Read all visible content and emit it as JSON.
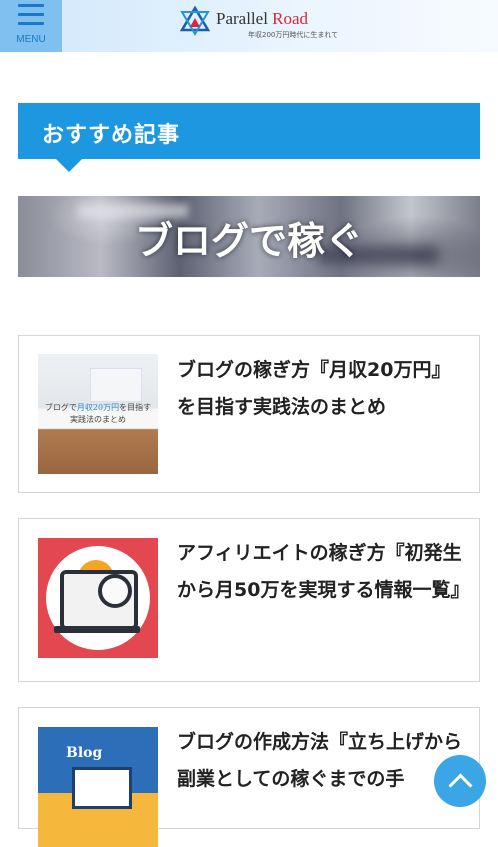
{
  "header": {
    "menu_label": "MENU",
    "logo_title_part1": "Parallel ",
    "logo_title_part2": "Road",
    "logo_tagline": "年収200万円時代に生まれて"
  },
  "section": {
    "title": "おすすめ記事"
  },
  "banner": {
    "text": "ブログで稼ぐ"
  },
  "articles": [
    {
      "title": "ブログの稼ぎ方『月収20万円』を目指す実践法のまとめ",
      "thumb_caption_pre": "ブログで",
      "thumb_caption_hl": "月収20万円",
      "thumb_caption_post": "を目指す",
      "thumb_caption_line2": "実践法のまとめ"
    },
    {
      "title": "アフィリエイトの稼ぎ方『初発生から月50万を実現する情報一覧』"
    },
    {
      "title": "ブログの作成方法『立ち上げから副業としての稼ぐまでの手",
      "thumb_word": "Blog"
    }
  ],
  "colors": {
    "accent": "#1c97e0",
    "menu_bg": "#7fc0f0",
    "logo_red": "#d6283a",
    "fab": "#3aa6e6"
  },
  "icons": {
    "menu": "hamburger-icon",
    "logo": "parallel-road-logo",
    "back_to_top": "chevron-up-icon"
  }
}
